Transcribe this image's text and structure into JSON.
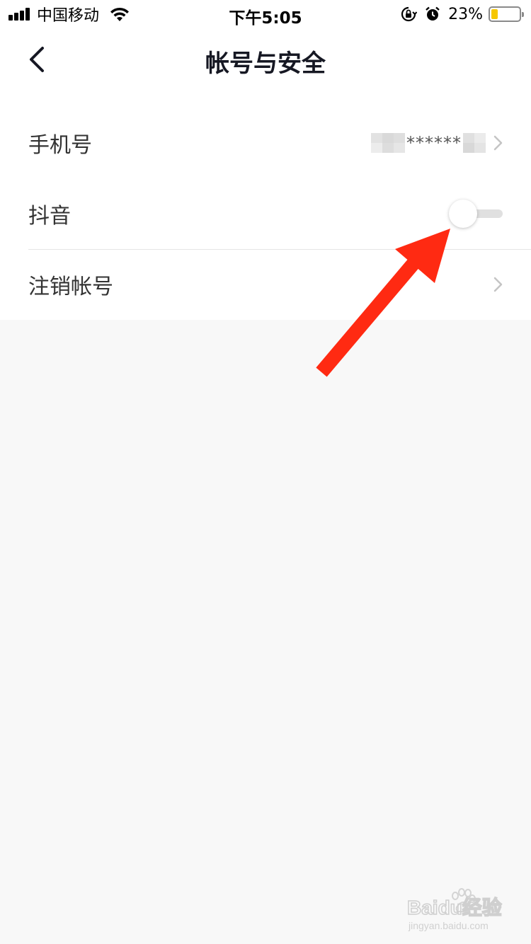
{
  "status_bar": {
    "carrier": "中国移动",
    "time": "下午5:05",
    "battery_percent": "23%",
    "battery_level": 0.23,
    "battery_color": "#f6c700",
    "icons": [
      "signal-icon",
      "wifi-icon",
      "rotation-lock-icon",
      "alarm-icon",
      "battery-icon"
    ]
  },
  "header": {
    "title": "帐号与安全",
    "back_icon": "chevron-left-icon"
  },
  "settings": {
    "phone": {
      "label": "手机号",
      "masked_digits": "******"
    },
    "douyin": {
      "label": "抖音",
      "toggle_on": false
    },
    "cancel_account": {
      "label": "注销帐号"
    }
  },
  "watermark": {
    "brand": "Baidu经验",
    "url": "jingyan.baidu.com"
  },
  "colors": {
    "annotation_arrow": "#ff2a12",
    "page_background": "#f8f8f8",
    "list_background": "#ffffff"
  }
}
